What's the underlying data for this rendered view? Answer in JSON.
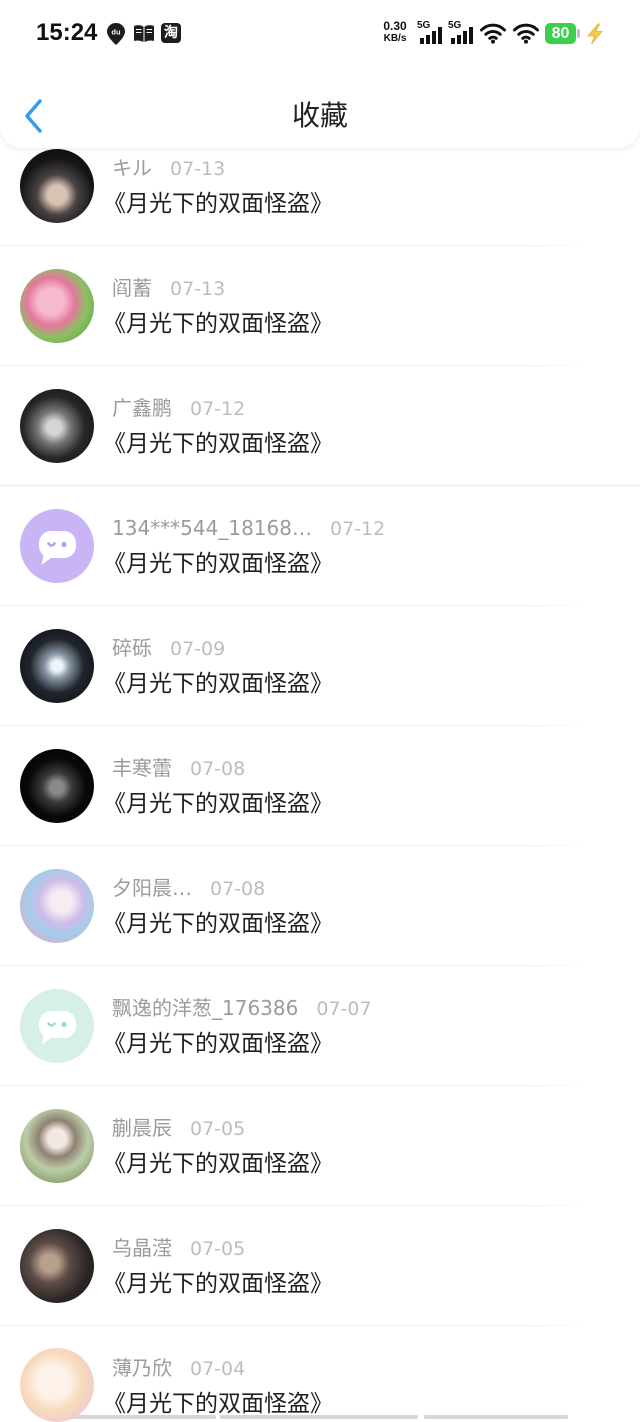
{
  "status_bar": {
    "time": "15:24",
    "du_logo_text": "du",
    "taobao_logo_text": "淘",
    "net_speed_value": "0.30",
    "net_speed_unit": "KB/s",
    "sim1_network": "5G",
    "sim2_network": "5G",
    "battery_level": "80",
    "icons": [
      "du-location-icon",
      "book-icon",
      "taobao-icon",
      "signal-icon",
      "wifi-icon",
      "battery-icon",
      "charging-bolt-icon"
    ]
  },
  "header": {
    "title": "收藏",
    "back_icon": "chevron-left-icon"
  },
  "colors": {
    "accent": "#2d9cf0",
    "battery_fill": "#3ccf4e",
    "charging_bolt": "#f2c94c",
    "default_avatar_purple": "#c9b5f6",
    "default_avatar_teal": "#d6f0e8",
    "name_text": "#9b9b9b",
    "date_text": "#bdbdbd",
    "title_text": "#1f1f1f"
  },
  "favorites": [
    {
      "user": "キル",
      "date": "07-13",
      "title": "《月光下的双面怪盗》",
      "avatar_icon": "user-photo-avatar"
    },
    {
      "user": "阎蓄",
      "date": "07-13",
      "title": "《月光下的双面怪盗》",
      "avatar_icon": "user-photo-avatar"
    },
    {
      "user": "广鑫鹏",
      "date": "07-12",
      "title": "《月光下的双面怪盗》",
      "avatar_icon": "user-photo-avatar"
    },
    {
      "user": "134***544_18168…",
      "date": "07-12",
      "title": "《月光下的双面怪盗》",
      "avatar_icon": "default-chat-avatar"
    },
    {
      "user": "碎砾",
      "date": "07-09",
      "title": "《月光下的双面怪盗》",
      "avatar_icon": "user-photo-avatar"
    },
    {
      "user": "丰寒蕾",
      "date": "07-08",
      "title": "《月光下的双面怪盗》",
      "avatar_icon": "user-photo-avatar"
    },
    {
      "user": "夕阳晨…",
      "date": "07-08",
      "title": "《月光下的双面怪盗》",
      "avatar_icon": "user-photo-avatar"
    },
    {
      "user": "飘逸的洋葱_176386",
      "date": "07-07",
      "title": "《月光下的双面怪盗》",
      "avatar_icon": "default-chat-avatar"
    },
    {
      "user": "蒯晨辰",
      "date": "07-05",
      "title": "《月光下的双面怪盗》",
      "avatar_icon": "user-photo-avatar"
    },
    {
      "user": "乌晶滢",
      "date": "07-05",
      "title": "《月光下的双面怪盗》",
      "avatar_icon": "user-photo-avatar"
    },
    {
      "user": "薄乃欣",
      "date": "07-04",
      "title": "《月光下的双面怪盗》",
      "avatar_icon": "user-photo-avatar"
    }
  ]
}
